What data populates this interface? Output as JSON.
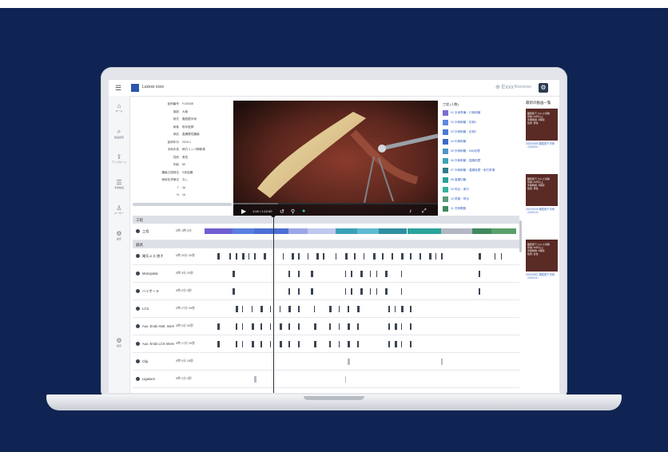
{
  "app": {
    "logo_text": "Luxxxs xxxx",
    "right_icons": {
      "status": "⊕ Exxx",
      "account": "Bxxxxxxx"
    }
  },
  "sidebar": {
    "items": [
      {
        "icon": "home-icon",
        "glyph": "⌂",
        "label": "ホーム"
      },
      {
        "icon": "search-icon",
        "glyph": "⌕",
        "label": "動画検索"
      },
      {
        "icon": "upload-icon",
        "glyph": "⇪",
        "label": "アップロード"
      },
      {
        "icon": "list-icon",
        "glyph": "☰",
        "label": "手術動画"
      },
      {
        "icon": "user-icon",
        "glyph": "♙",
        "label": "ユーザー"
      },
      {
        "icon": "settings-icon",
        "glyph": "⚙",
        "label": "設定"
      },
      {
        "icon": "gear-icon",
        "glyph": "⚙",
        "label": "設定"
      }
    ]
  },
  "meta": {
    "rows": [
      {
        "k": "症例番号",
        "v": "H-00438"
      },
      {
        "k": "施設",
        "v": "大阪"
      },
      {
        "k": "術式",
        "v": "腹腔鏡手術"
      },
      {
        "k": "術者",
        "v": "助手医師"
      },
      {
        "k": "病名",
        "v": "直腸悪性腫瘍"
      },
      {
        "k": "症例年月",
        "v": "2019.1"
      },
      {
        "k": "手術手技",
        "v": "側方リンパ節郭清"
      },
      {
        "k": "性別",
        "v": "男性"
      },
      {
        "k": "年齢",
        "v": "60"
      },
      {
        "k": "腫瘍占居部位",
        "v": "S状結腸"
      },
      {
        "k": "術前化学療法",
        "v": "なし"
      },
      {
        "k": "T",
        "v": "3a"
      },
      {
        "k": "N",
        "v": "1b"
      }
    ]
  },
  "video": {
    "time": "1:04 / 1:12:00",
    "progress": 0.22
  },
  "phases": {
    "title": "工程 (人数)",
    "items": [
      {
        "label": "01 手術準備・口側剥離",
        "color": "#7b6fd1"
      },
      {
        "label": "02 外側剥離・肛側1",
        "color": "#5f87e0"
      },
      {
        "label": "03 外側剥離・肛側2",
        "color": "#4a7bd6"
      },
      {
        "label": "04 内側剥離",
        "color": "#3c6cc7"
      },
      {
        "label": "05 外側剥離・IMA処理",
        "color": "#4f95c9"
      },
      {
        "label": "06 外側剥離・直腸前壁",
        "color": "#3aa3b8"
      },
      {
        "label": "07 外側剥離・直腸後壁・側方郭清",
        "color": "#2f7c8c"
      },
      {
        "label": "08 直腸切離",
        "color": "#2aa39a"
      },
      {
        "label": "09 吻合・側方",
        "color": "#36b29c"
      },
      {
        "label": "10 再建・吻合",
        "color": "#5a9c76"
      },
      {
        "label": "11 洗浄閉腹",
        "color": "#3f8a5d"
      }
    ]
  },
  "timeline": {
    "section1": "工程",
    "section2": "器具",
    "phase_row": {
      "name": "工程",
      "value": "0時 1時 0分",
      "segments": [
        {
          "start": 0.0,
          "end": 0.09,
          "color": "#6f5fd0"
        },
        {
          "start": 0.09,
          "end": 0.16,
          "color": "#5a7fe0"
        },
        {
          "start": 0.16,
          "end": 0.27,
          "color": "#4b6fd4"
        },
        {
          "start": 0.27,
          "end": 0.33,
          "color": "#9ba7e6"
        },
        {
          "start": 0.33,
          "end": 0.42,
          "color": "#bfc8ee"
        },
        {
          "start": 0.42,
          "end": 0.49,
          "color": "#3aa0b8"
        },
        {
          "start": 0.49,
          "end": 0.56,
          "color": "#5fbad0"
        },
        {
          "start": 0.56,
          "end": 0.65,
          "color": "#2f8fa0"
        },
        {
          "start": 0.65,
          "end": 0.76,
          "color": "#2aa39a"
        },
        {
          "start": 0.76,
          "end": 0.86,
          "color": "#b4b8c4"
        },
        {
          "start": 0.86,
          "end": 0.92,
          "color": "#3f8a5d"
        },
        {
          "start": 0.92,
          "end": 1.0,
          "color": "#5aa06a"
        }
      ]
    },
    "rows": [
      {
        "name": "電気メス 鉗子",
        "value": "0時 29分 30秒",
        "ticks": [
          0.04,
          0.08,
          0.1,
          0.12,
          0.14,
          0.16,
          0.19,
          0.22,
          0.25,
          0.28,
          0.3,
          0.33,
          0.36,
          0.38,
          0.42,
          0.45,
          0.48,
          0.51,
          0.54,
          0.57,
          0.6,
          0.63,
          0.66,
          0.69,
          0.72,
          0.74,
          0.76,
          0.88,
          0.93,
          0.95
        ]
      },
      {
        "name": "Monopolar",
        "value": "0時 3分 20秒",
        "ticks": [
          0.09,
          0.27,
          0.3,
          0.34,
          0.45,
          0.47,
          0.5,
          0.53,
          0.55,
          0.58,
          0.63,
          0.88
        ]
      },
      {
        "name": "バイポーラ",
        "value": "0時 0分 0秒",
        "ticks": [
          0.09,
          0.27,
          0.3,
          0.34,
          0.45,
          0.47,
          0.5,
          0.53,
          0.55,
          0.58,
          0.63,
          0.88
        ]
      },
      {
        "name": "LCS",
        "value": "0時 27分 39秒",
        "ticks": [
          0.1,
          0.12,
          0.15,
          0.18,
          0.21,
          0.24,
          0.27,
          0.3,
          0.35,
          0.4,
          0.43,
          0.46,
          0.49,
          0.59,
          0.61,
          0.63,
          0.66
        ]
      },
      {
        "name": "Aux. Endo Instr. Interv.",
        "value": "0時 9分 30秒",
        "ticks": [
          0.04,
          0.1,
          0.12,
          0.15,
          0.18,
          0.21,
          0.24,
          0.27,
          0.3,
          0.35,
          0.4,
          0.43,
          0.46,
          0.49,
          0.59,
          0.61,
          0.63,
          0.66
        ]
      },
      {
        "name": "Aux. Endo LCS Interv.",
        "value": "0時 17分 29秒",
        "ticks": [
          0.04,
          0.1,
          0.12,
          0.15,
          0.18,
          0.21,
          0.24,
          0.27,
          0.3,
          0.35,
          0.4,
          0.43,
          0.46,
          0.49,
          0.59,
          0.61,
          0.63,
          0.66
        ]
      },
      {
        "name": "Clip",
        "value": "0時 0分 18秒",
        "ticks": [
          0.46,
          0.76
        ]
      },
      {
        "name": "Ligasure",
        "value": "0時 1分 0秒",
        "ticks": [
          0.16,
          0.45
        ]
      }
    ],
    "cursor": 0.22
  },
  "related": {
    "title": "最新の動画一覧",
    "cases": [
      {
        "lines": [
          "腹腔鏡下 ロドミ切除",
          "年齢: 60代以上",
          "手術時間: 2時間",
          "性別: 男性"
        ],
        "caption": "2022/04/06 腹腔鏡下手術 〔2022/01〕"
      },
      {
        "lines": [
          "腹腔鏡下 ロドミ切除",
          "年齢: 60代以上",
          "手術時間: 3時間",
          "性別: 男性"
        ],
        "caption": "2022/03/15 腹腔鏡下手術 〔2021/12〕"
      },
      {
        "lines": [
          "腹腔鏡下 ロドミ切除",
          "年齢: 50代以上",
          "手術時間: 2時間",
          "性別: 女性"
        ],
        "caption": "2022/03/01 腹腔鏡下手術 〔2021/11〕"
      }
    ]
  }
}
